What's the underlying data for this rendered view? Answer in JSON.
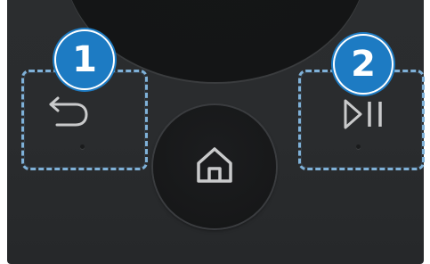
{
  "badges": {
    "first": "1",
    "second": "2"
  },
  "buttons": {
    "back": {
      "icon": "return-arrow-icon"
    },
    "home": {
      "icon": "home-icon"
    },
    "play_pause": {
      "icon": "play-pause-icon"
    }
  },
  "colors": {
    "badge_fill": "#1d7bc3",
    "highlight_border": "#7fb1d8",
    "remote_body": "#2a2c2e",
    "icon_stroke": "#c9cacb"
  }
}
